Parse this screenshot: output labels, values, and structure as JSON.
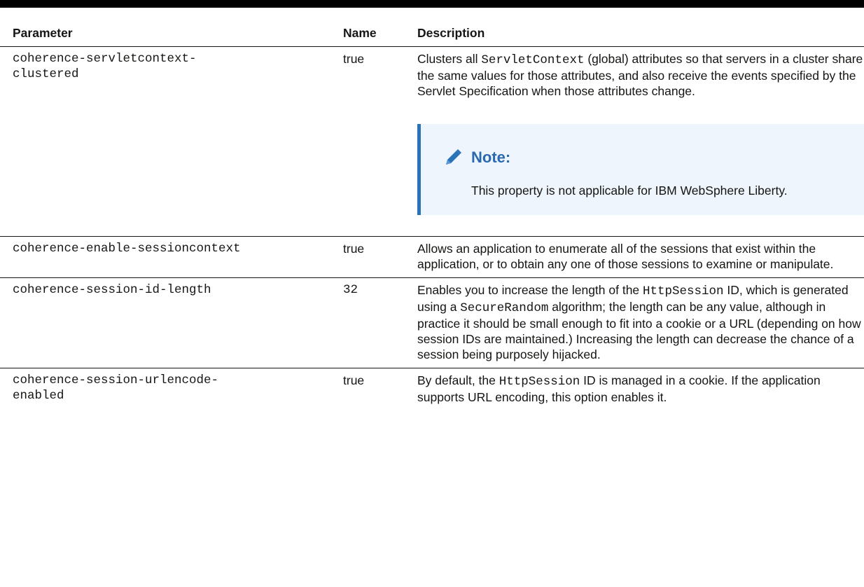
{
  "table": {
    "headers": [
      "Parameter",
      "Name",
      "Description"
    ],
    "rows": [
      {
        "parameter_line1": "coherence-servletcontext-",
        "parameter_line2": "clustered",
        "name": "true",
        "desc_pre": "Clusters all ",
        "desc_code": "ServletContext",
        "desc_post": " (global) attributes so that servers in a cluster share the same values for those attributes, and also receive the events specified by the Servlet Specification when those attributes change.",
        "note": {
          "icon": "pencil-icon",
          "title": "Note:",
          "body": "This property is not applicable for IBM WebSphere Liberty."
        }
      },
      {
        "parameter": "coherence-enable-sessioncontext",
        "name": "true",
        "description": "Allows an application to enumerate all of the sessions that exist within the application, or to obtain any one of those sessions to examine or manipulate."
      },
      {
        "parameter": "coherence-session-id-length",
        "name": "32",
        "desc_pre": "Enables you to increase the length of the ",
        "desc_code1": "HttpSession",
        "desc_mid": " ID, which is generated using a ",
        "desc_code2": "SecureRandom",
        "desc_post": " algorithm; the length can be any value, although in practice it should be small enough to fit into a cookie or a URL (depending on how session IDs are maintained.) Increasing the length can decrease the chance of a session being purposely hijacked."
      },
      {
        "parameter_line1": "coherence-session-urlencode-",
        "parameter_line2": "enabled",
        "name": "true",
        "desc_pre": "By default, the ",
        "desc_code": "HttpSession",
        "desc_post": " ID is managed in a cookie. If the application supports URL encoding, this option enables it."
      }
    ]
  },
  "colors": {
    "note_accent": "#2a73b8",
    "note_background": "#eef5fc",
    "note_title": "#2a6aae"
  }
}
